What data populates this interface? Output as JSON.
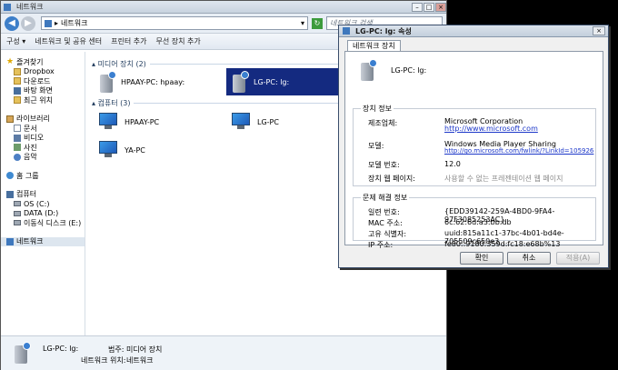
{
  "explorer": {
    "title": "네트워크",
    "address_crumb": "네트워크",
    "address_arrow": "▸",
    "search_placeholder": "네트워크 검색",
    "toolbar": [
      "구성 ▾",
      "네트워크 및 공유 센터",
      "프린터 추가",
      "무선 장치 추가"
    ],
    "sidebar": {
      "favorites": {
        "label": "즐겨찾기",
        "items": [
          "Dropbox",
          "다운로드",
          "바탕 화면",
          "최근 위치"
        ]
      },
      "libraries": {
        "label": "라이브러리",
        "items": [
          "문서",
          "비디오",
          "사진",
          "음악"
        ]
      },
      "homegroup": {
        "label": "홈 그룹"
      },
      "computer": {
        "label": "컴퓨터",
        "items": [
          "OS (C:)",
          "DATA (D:)",
          "이동식 디스크 (E:)"
        ]
      },
      "network": {
        "label": "네트워크"
      }
    },
    "sections": {
      "media": {
        "label": "미디어 장치 (2)",
        "items": [
          "HPAAY-PC: hpaay:",
          "LG-PC: lg:"
        ]
      },
      "computers": {
        "label": "컴퓨터 (3)",
        "items": [
          "HPAAY-PC",
          "LG-PC",
          "YA-PC"
        ]
      }
    },
    "details": {
      "name": "LG-PC: lg:",
      "category_label": "범주:",
      "category_value": "미디어 장치",
      "location_label": "네트워크 위치:",
      "location_value": "네트워크"
    }
  },
  "dialog": {
    "title": "LG-PC: lg: 속성",
    "tab": "네트워크 장치",
    "device_name": "LG-PC: lg:",
    "device_info": {
      "label": "장치 정보",
      "manufacturer_label": "제조업체:",
      "manufacturer": "Microsoft Corporation",
      "manufacturer_url": "http://www.microsoft.com",
      "model_label": "모델:",
      "model": "Windows Media Player Sharing",
      "model_url": "http://go.microsoft.com/fwlink/?LinkId=105926",
      "model_number_label": "모델 번호:",
      "model_number": "12.0",
      "webpage_label": "장치 웹 페이지:",
      "webpage": "사용할 수 없는 프레젠테이션 웹 페이지"
    },
    "troubleshooting": {
      "label": "문제 해결 정보",
      "serial_label": "일련 번호:",
      "serial": "{EDD39142-259A-4BD0-9FA4-97F3085253AC}",
      "mac_label": "MAC 주소:",
      "mac": "6c:62:6d:a3:bb:db",
      "uid_label": "고유 식별자:",
      "uid": "uuid:815a11c1-37bc-4b01-bd4e-705509c650e3",
      "ip_label": "IP 주소:",
      "ip": "fe80::9180:359d:fc18:e68b%13"
    },
    "buttons": {
      "ok": "확인",
      "cancel": "취소",
      "apply": "적용(A)"
    }
  }
}
